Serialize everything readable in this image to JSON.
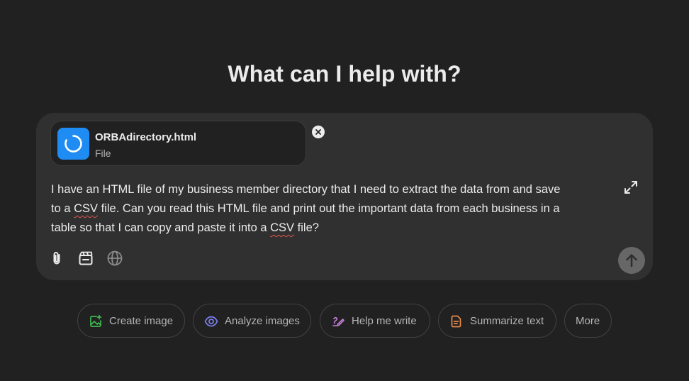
{
  "heading": "What can I help with?",
  "attachment": {
    "file_name": "ORBAdirectory.html",
    "file_type": "File",
    "icon": "file-html-icon",
    "icon_color": "#1f8cf3"
  },
  "composer": {
    "prompt_parts": [
      "I have an HTML file of my business member directory that I need to extract the data from and save\nto a ",
      "CSV",
      " file. Can you read this HTML file and print out the important data from each business in a\ntable so that I can copy and paste it into a ",
      "CSV",
      " file?"
    ],
    "tools": [
      "attach-icon",
      "video-icon",
      "globe-icon"
    ],
    "send_icon": "arrow-up-icon"
  },
  "suggestions": [
    {
      "label": "Create image",
      "icon": "image-plus-icon",
      "color": "#3fb950"
    },
    {
      "label": "Analyze images",
      "icon": "eye-icon",
      "color": "#7b7ff0"
    },
    {
      "label": "Help me write",
      "icon": "pen-icon",
      "color": "#c77ddb"
    },
    {
      "label": "Summarize text",
      "icon": "document-icon",
      "color": "#e8894b"
    },
    {
      "label": "More",
      "icon": "",
      "color": "#b4b4b4"
    }
  ]
}
